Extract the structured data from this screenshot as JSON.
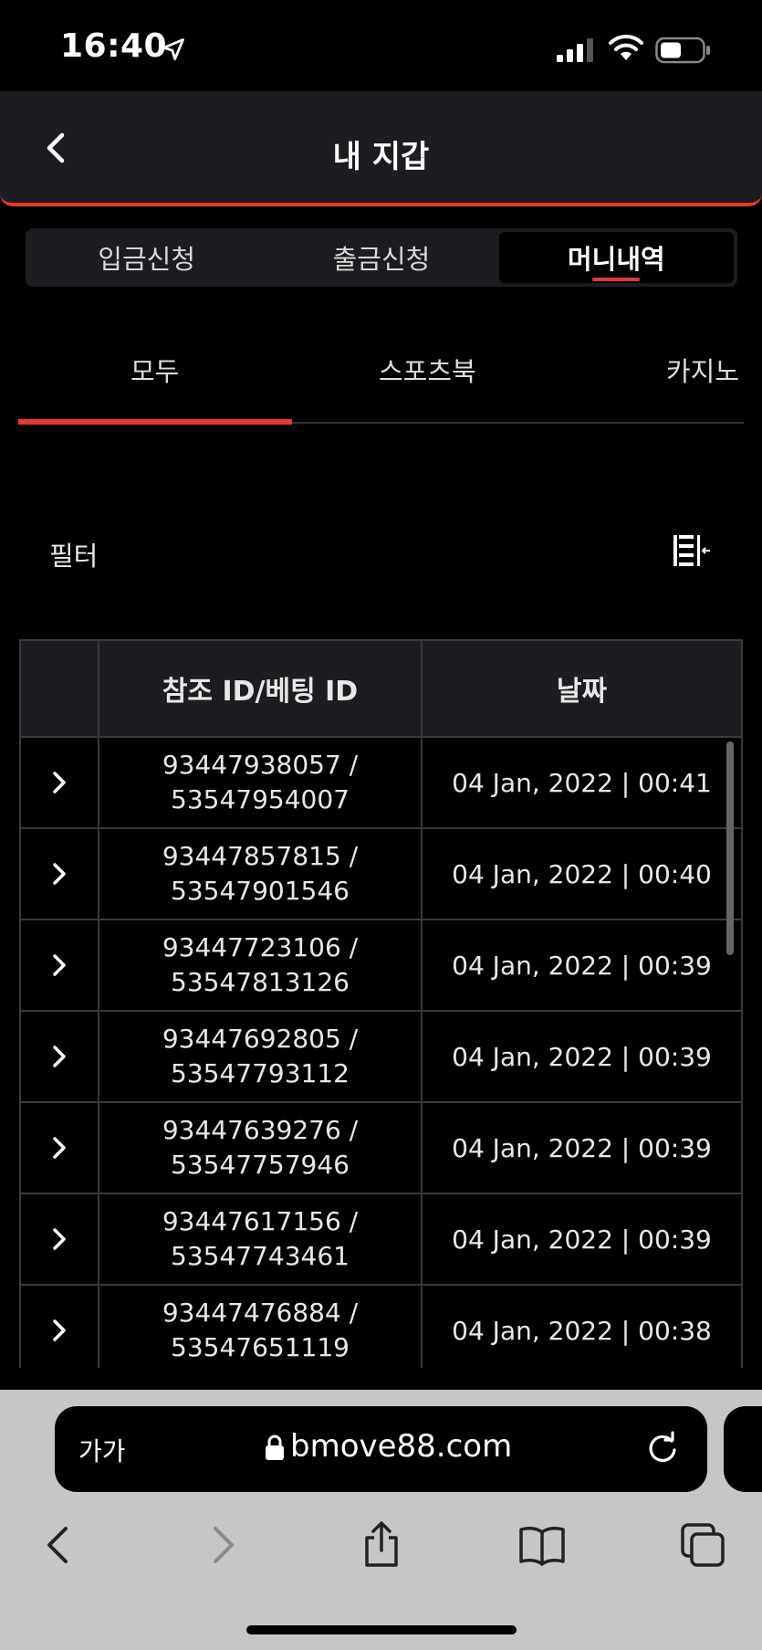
{
  "status_bar": {
    "time": "16:40"
  },
  "header": {
    "title": "내 지갑"
  },
  "segment_tabs": [
    {
      "label": "입금신청",
      "active": false
    },
    {
      "label": "출금신청",
      "active": false
    },
    {
      "label": "머니내역",
      "active": true
    }
  ],
  "category_tabs": [
    {
      "label": "모두",
      "active": true
    },
    {
      "label": "스포츠북",
      "active": false
    },
    {
      "label": "카지노",
      "active": false
    }
  ],
  "filter": {
    "label": "필터",
    "icon": "filter-columns-icon"
  },
  "table": {
    "headers": [
      "",
      "참조 ID/베팅 ID",
      "날짜"
    ],
    "rows": [
      {
        "ref_id": "93447938057 /",
        "bet_id": "53547954007",
        "date": "04 Jan, 2022 | 00:41"
      },
      {
        "ref_id": "93447857815 /",
        "bet_id": "53547901546",
        "date": "04 Jan, 2022 | 00:40"
      },
      {
        "ref_id": "93447723106 /",
        "bet_id": "53547813126",
        "date": "04 Jan, 2022 | 00:39"
      },
      {
        "ref_id": "93447692805 /",
        "bet_id": "53547793112",
        "date": "04 Jan, 2022 | 00:39"
      },
      {
        "ref_id": "93447639276 /",
        "bet_id": "53547757946",
        "date": "04 Jan, 2022 | 00:39"
      },
      {
        "ref_id": "93447617156 /",
        "bet_id": "53547743461",
        "date": "04 Jan, 2022 | 00:39"
      },
      {
        "ref_id": "93447476884 /",
        "bet_id": "53547651119",
        "date": "04 Jan, 2022 | 00:38"
      }
    ]
  },
  "browser": {
    "aa_label": "가가",
    "url": "bmove88.com"
  },
  "colors": {
    "accent": "#e63a2e",
    "header_bg": "#1c1d20",
    "toolbar_bg": "#c6c6c6"
  }
}
